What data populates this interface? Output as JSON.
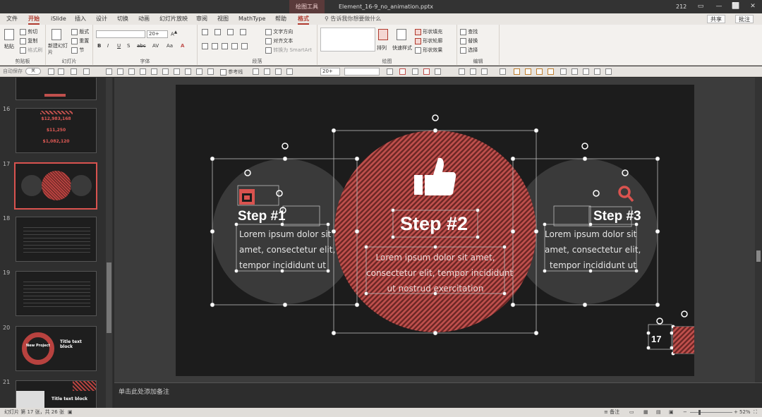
{
  "titlebar": {
    "context_tab": "绘图工具",
    "filename": "Element_16-9_no_animation.pptx",
    "count": "212",
    "minimize": "—",
    "restore": "▭",
    "maximize": "⬜",
    "close": "✕"
  },
  "tabs": [
    "文件",
    "开始",
    "iSlide",
    "插入",
    "设计",
    "切换",
    "动画",
    "幻灯片放映",
    "审阅",
    "视图",
    "MathType",
    "帮助",
    "格式"
  ],
  "tell_me": "告诉我你想要做什么",
  "share": "共享",
  "comments": "批注",
  "ribbon": {
    "clipboard": {
      "paste": "粘贴",
      "cut": "剪切",
      "copy": "复制",
      "format_painter": "格式刷",
      "label": "剪贴板"
    },
    "slides": {
      "new_slide": "新建幻灯片",
      "layout": "版式",
      "reset": "重置",
      "section": "节",
      "label": "幻灯片"
    },
    "font": {
      "font_size": "20+",
      "label": "字体"
    },
    "paragraph": {
      "text_direction": "文字方向",
      "align_text": "对齐文本",
      "smartart": "转换为 SmartArt",
      "label": "段落"
    },
    "drawing": {
      "arrange": "排列",
      "quick_styles": "快速样式",
      "shape_fill": "形状填充",
      "shape_outline": "形状轮廓",
      "shape_effects": "形状效果",
      "label": "绘图"
    },
    "editing": {
      "find": "查找",
      "replace": "替换",
      "select": "选择",
      "label": "编辑"
    }
  },
  "qat": {
    "autosave": "自动保存",
    "autosave_state": "关",
    "reference_line": "参考线",
    "font_size": "20+"
  },
  "thumbnails": [
    {
      "num": "",
      "kind": "dark-title"
    },
    {
      "num": "16",
      "kind": "numbers",
      "lines": [
        "$12,983,168",
        "$11,250",
        "$1,082,120"
      ]
    },
    {
      "num": "17",
      "kind": "circles",
      "selected": true
    },
    {
      "num": "18",
      "kind": "grid"
    },
    {
      "num": "19",
      "kind": "grid"
    },
    {
      "num": "20",
      "kind": "ring",
      "label": "New Project",
      "title": "Title text block"
    },
    {
      "num": "21",
      "kind": "title",
      "title": "Title text block"
    }
  ],
  "slide": {
    "step1_title": "Step #1",
    "step1_body": [
      "Lorem ipsum dolor sit",
      "amet, consectetur elit,",
      "tempor incididunt ut"
    ],
    "step2_title": "Step #2",
    "step2_body": [
      "Lorem ipsum dolor sit amet,",
      "consectetur elit, tempor incididunt",
      "ut nostrud exercitation"
    ],
    "step3_title": "Step #3",
    "step3_body": [
      "Lorem ipsum dolor sit",
      "amet, consectetur elit,",
      "tempor incididunt ut"
    ],
    "page_number": "17"
  },
  "notes_placeholder": "单击此处添加备注",
  "status": {
    "slide_info": "幻灯片 第 17 张，共 26 张",
    "notes": "备注",
    "zoom": "52%"
  },
  "colors": {
    "accent": "#c0504d",
    "stripe_red": "#b8423f",
    "slide_bg": "#1c1c1c"
  }
}
